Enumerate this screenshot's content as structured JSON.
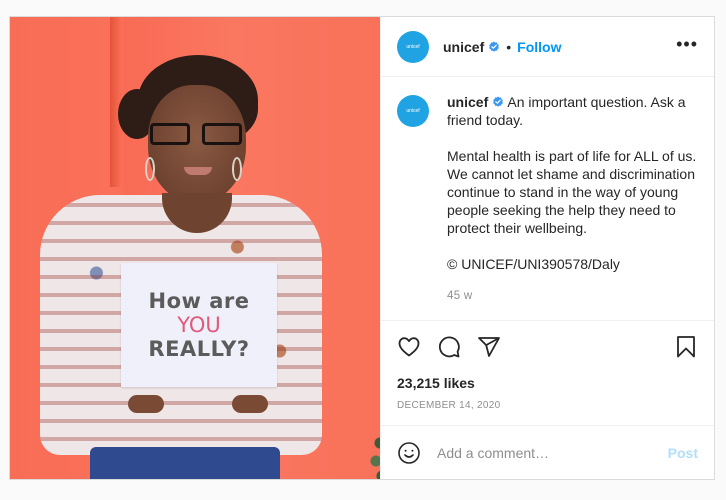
{
  "colors": {
    "accent": "#0095f6",
    "post_disabled": "#b2dffc",
    "avatar_bg": "#1fa3e3",
    "verified": "#3897f0",
    "muted": "#8e8e8e",
    "text": "#262626"
  },
  "photo": {
    "alt": "Young woman with glasses holding a hand-written sign against an orange wall",
    "sign": {
      "line1": "How are",
      "line2": "YOU",
      "line3": "REALLY?"
    }
  },
  "header": {
    "avatar_text": "unicef",
    "username": "unicef",
    "verified_icon": "verified-badge-icon",
    "separator": "•",
    "follow_label": "Follow",
    "more_icon": "more-options-icon",
    "more_label": "•••"
  },
  "caption": {
    "avatar_text": "unicef",
    "username": "unicef",
    "first_line": "An important question. Ask a friend today.",
    "paragraph": "Mental health is part of life for ALL of us. We cannot let shame and discrimination continue to stand in the way of young people seeking the help they need to protect their wellbeing.",
    "credit": "© UNICEF/UNI390578/Daly",
    "relative_time": "45 w"
  },
  "actions": {
    "icons": [
      "heart-icon",
      "comment-icon",
      "share-icon",
      "bookmark-icon"
    ],
    "likes": "23,215 likes",
    "date": "DECEMBER 14, 2020"
  },
  "comment": {
    "emoji_icon": "emoji-icon",
    "placeholder": "Add a comment…",
    "value": "",
    "post_label": "Post"
  }
}
